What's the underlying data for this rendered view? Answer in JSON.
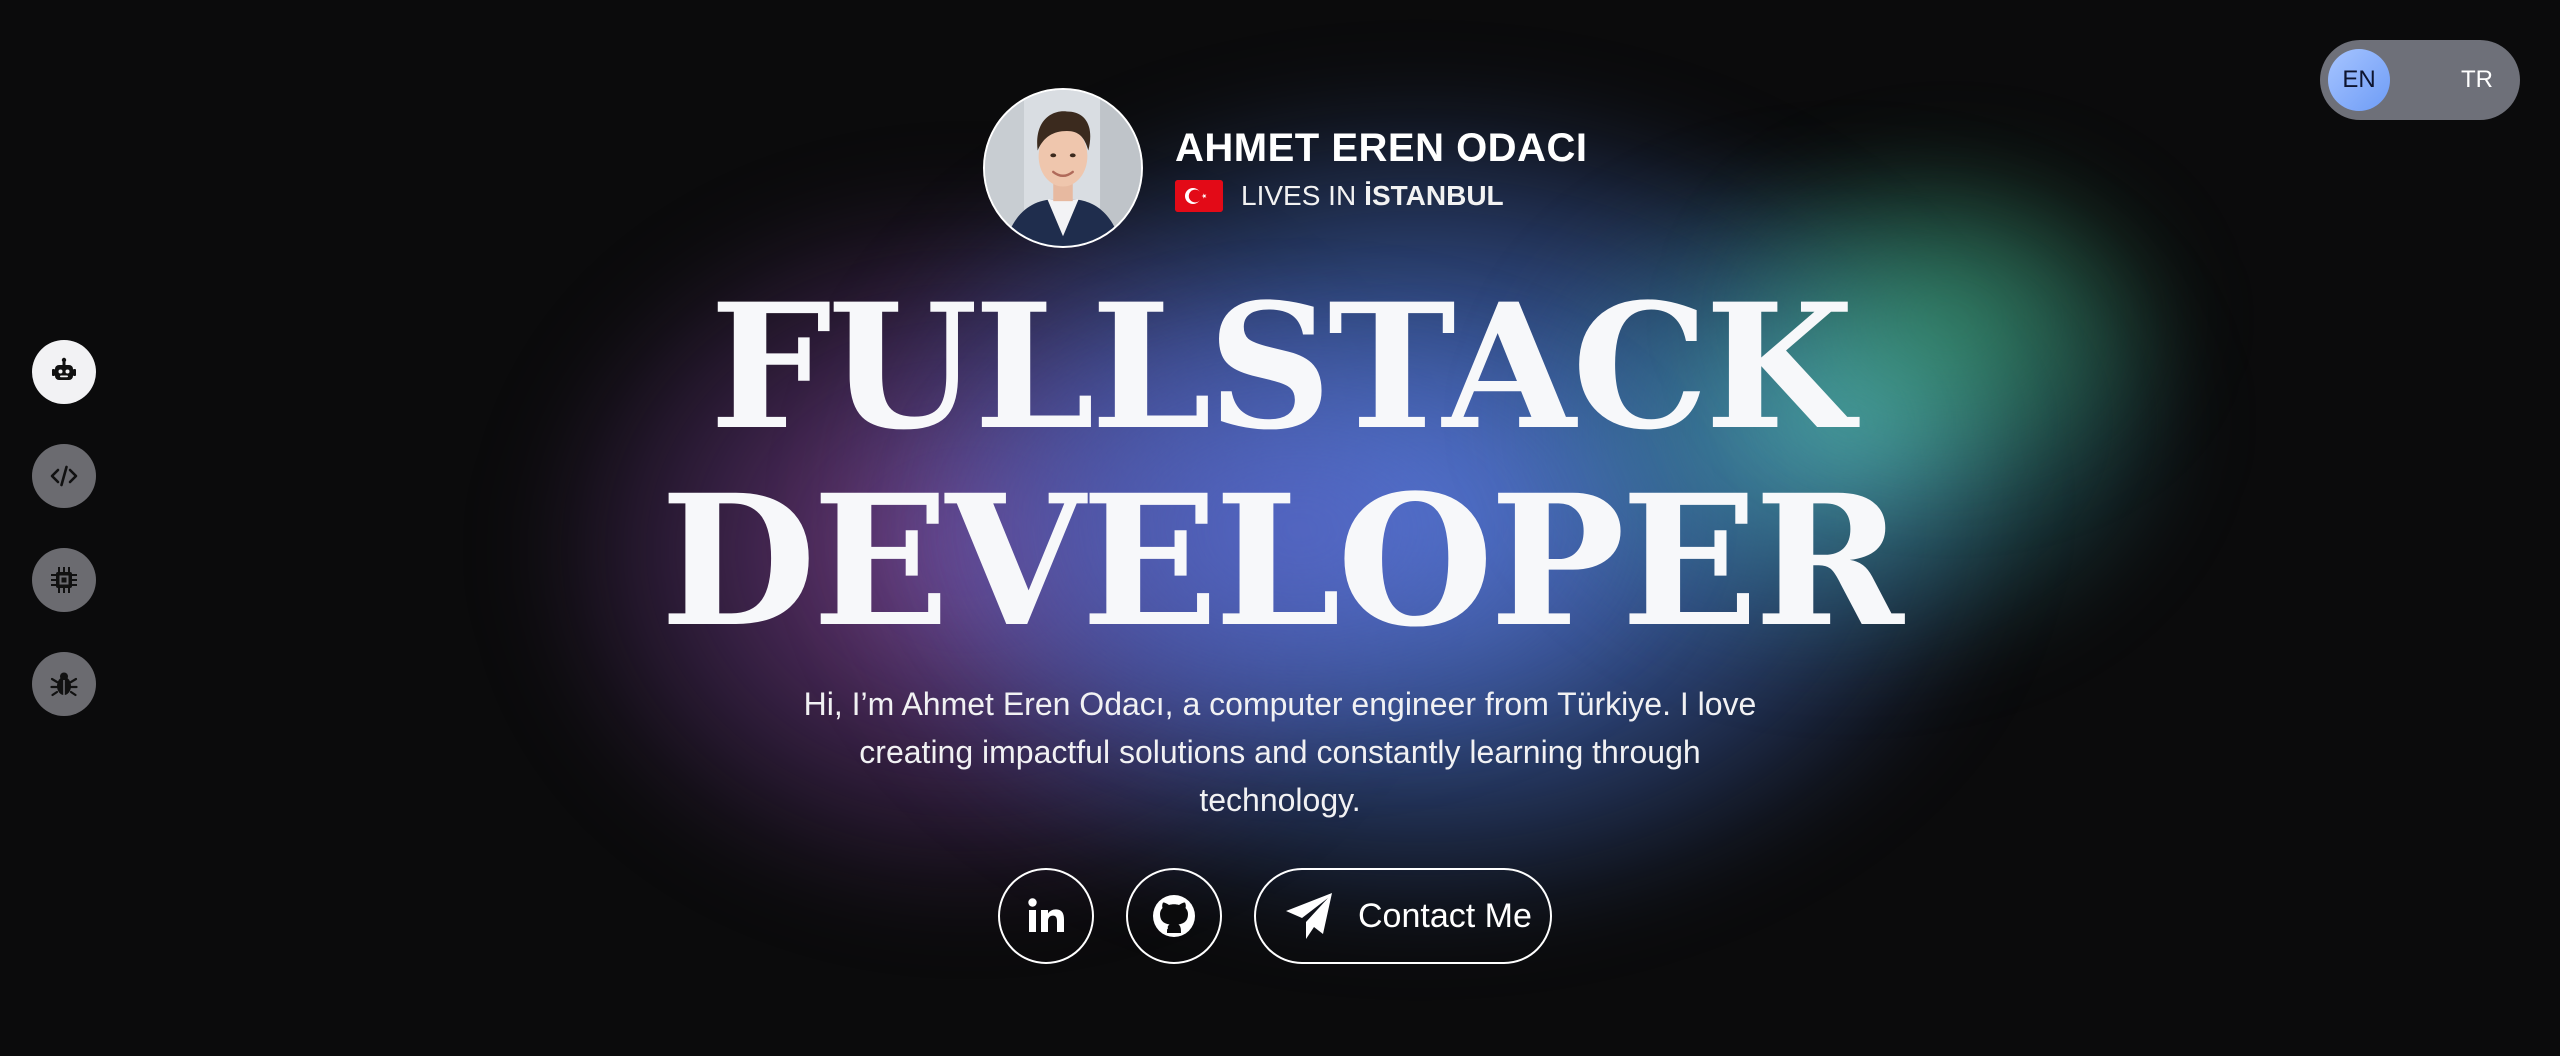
{
  "language_toggle": {
    "active": "EN",
    "inactive": "TR"
  },
  "side_nav": {
    "items": [
      {
        "icon": "robot-icon",
        "active": true
      },
      {
        "icon": "code-icon",
        "active": false
      },
      {
        "icon": "chip-icon",
        "active": false
      },
      {
        "icon": "bug-icon",
        "active": false
      }
    ]
  },
  "profile": {
    "name": "AHMET EREN ODACI",
    "lives_prefix": "LIVES IN",
    "city": "İSTANBUL",
    "flag_icon": "turkey-flag-icon"
  },
  "hero": {
    "title_line1": "FULLSTACK",
    "title_line2": "DEVELOPER",
    "intro": "Hi, I’m Ahmet Eren Odacı, a computer engineer from Türkiye. I love creating impactful solutions and constantly learning through technology."
  },
  "actions": {
    "linkedin_icon": "linkedin-icon",
    "github_icon": "github-icon",
    "contact_label": "Contact Me",
    "contact_icon": "paper-plane-icon"
  },
  "colors": {
    "background": "#0b0b0c",
    "glow_purple": "#8c4696",
    "glow_blue": "#5082dc",
    "glow_teal": "#5ac8c8",
    "toggle_bg": "#6e7079",
    "toggle_active": "#8fb3fb"
  }
}
